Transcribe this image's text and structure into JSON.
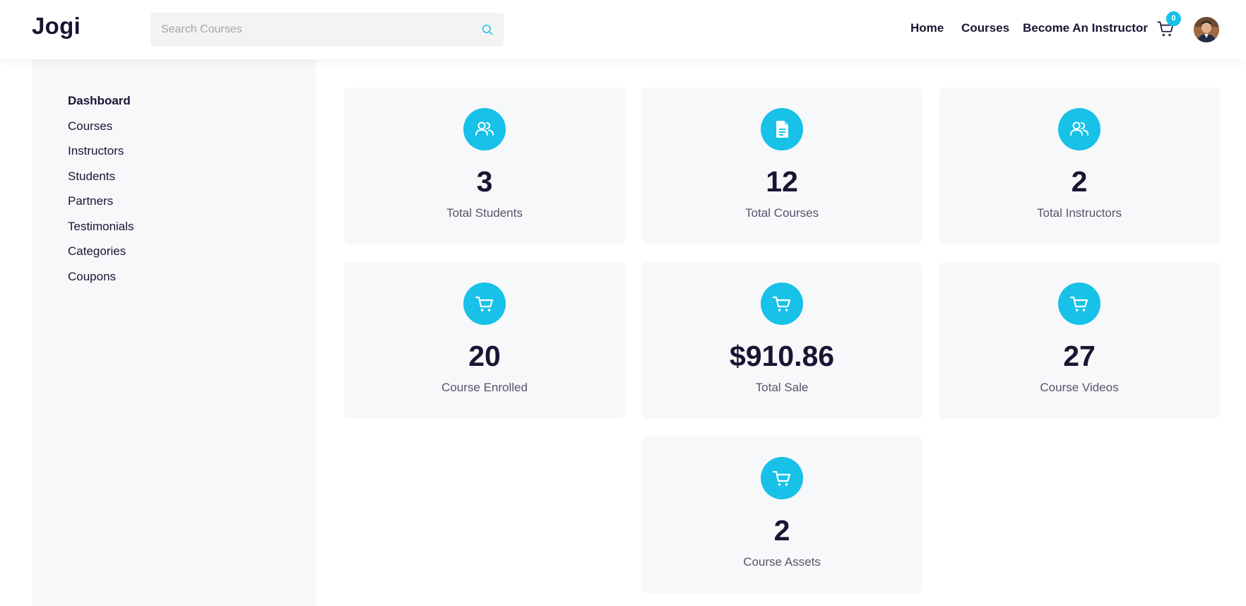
{
  "app": {
    "logo": "Jogi"
  },
  "search": {
    "placeholder": "Search Courses",
    "value": ""
  },
  "nav": {
    "home": "Home",
    "courses": "Courses",
    "become_instructor": "Become An Instructor",
    "cart_count": "0"
  },
  "sidebar": {
    "items": [
      {
        "label": "Dashboard",
        "active": true
      },
      {
        "label": "Courses"
      },
      {
        "label": "Instructors"
      },
      {
        "label": "Students"
      },
      {
        "label": "Partners"
      },
      {
        "label": "Testimonials"
      },
      {
        "label": "Categories"
      },
      {
        "label": "Coupons"
      }
    ]
  },
  "stats": [
    {
      "value": "3",
      "label": "Total Students",
      "icon": "users-icon"
    },
    {
      "value": "12",
      "label": "Total Courses",
      "icon": "document-icon"
    },
    {
      "value": "2",
      "label": "Total Instructors",
      "icon": "users-icon"
    },
    {
      "value": "20",
      "label": "Course Enrolled",
      "icon": "cart-icon"
    },
    {
      "value": "$910.86",
      "label": "Total Sale",
      "icon": "cart-icon"
    },
    {
      "value": "27",
      "label": "Course Videos",
      "icon": "cart-icon"
    },
    {
      "value": "2",
      "label": "Course Assets",
      "icon": "cart-icon"
    }
  ],
  "colors": {
    "accent": "#17c1e8",
    "text_dark": "#1c1433",
    "card_bg": "#f7f8fa"
  }
}
